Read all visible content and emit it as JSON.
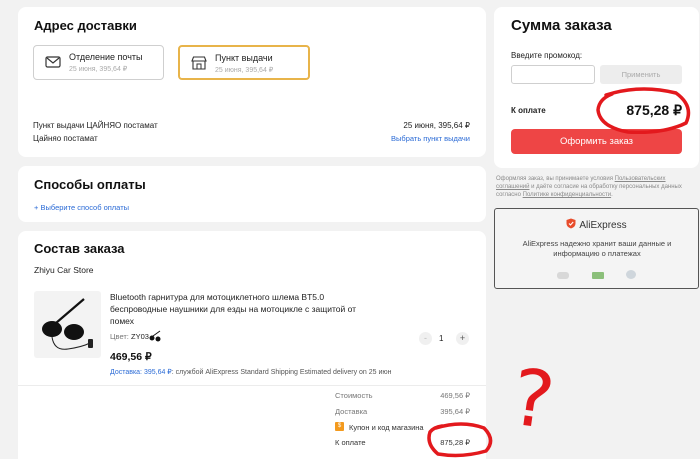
{
  "delivery": {
    "title": "Адрес доставки",
    "options": [
      {
        "label": "Отделение почты",
        "sub": "25 июня, 395,64 ₽"
      },
      {
        "label": "Пункт выдачи",
        "sub": "25 июня, 395,64 ₽"
      }
    ],
    "pickup_name": "Пункт выдачи ЦАЙНЯО постамат",
    "pickup_date": "25 июня, 395,64 ₽",
    "pickup_sub": "Цайняо постамат",
    "choose_link": "Выбрать пункт выдачи"
  },
  "payment": {
    "title": "Способы оплаты",
    "choose_link": "+ Выберите способ оплаты"
  },
  "order": {
    "title": "Состав заказа",
    "store": "Zhiyu Car Store",
    "product_title": "Bluetooth гарнитура для мотоциклетного шлема BT5.0 беспроводные наушники для езды на мотоцикле с защитой от помех",
    "color_label": "Цвет:",
    "color_value": "ZY03",
    "price": "469,56 ₽",
    "qty_minus": "-",
    "qty": "1",
    "qty_plus": "+",
    "shipping_label": "Доставка: 395,64 ₽",
    "shipping_text": ": службой AliExpress Standard Shipping  Estimated delivery on 25 июн",
    "totals": {
      "cost_label": "Стоимость",
      "cost_value": "469,56 ₽",
      "delivery_label": "Доставка",
      "delivery_value": "395,64 ₽",
      "coupon_badge": "$",
      "coupon_label": "Купон и код магазина",
      "pay_label": "К оплате",
      "pay_value": "875,28 ₽"
    }
  },
  "summary": {
    "title": "Сумма заказа",
    "promo_label": "Введите промокод:",
    "promo_placeholder": "",
    "apply_button": "Применить",
    "pay_label": "К оплате",
    "pay_value": "875,28 ₽",
    "order_button": "Оформить заказ"
  },
  "legal": {
    "text1": "Оформляя заказ, вы принимаете условия ",
    "link1": "Пользовательских соглашений",
    "text2": " и даёте согласие на обработку персональных данных согласно ",
    "link2": "Политике конфиденциальности",
    "text3": "."
  },
  "aliexpress": {
    "brand": "AliExpress",
    "text": "AliExpress надежно хранит ваши данные и информацию о платежах"
  },
  "annotation": {
    "question": "?"
  },
  "colors": {
    "accent_red": "#ee4545",
    "selected_border": "#e8b44a",
    "link_blue": "#2b6bd6",
    "annotation_red": "#e3191d"
  }
}
